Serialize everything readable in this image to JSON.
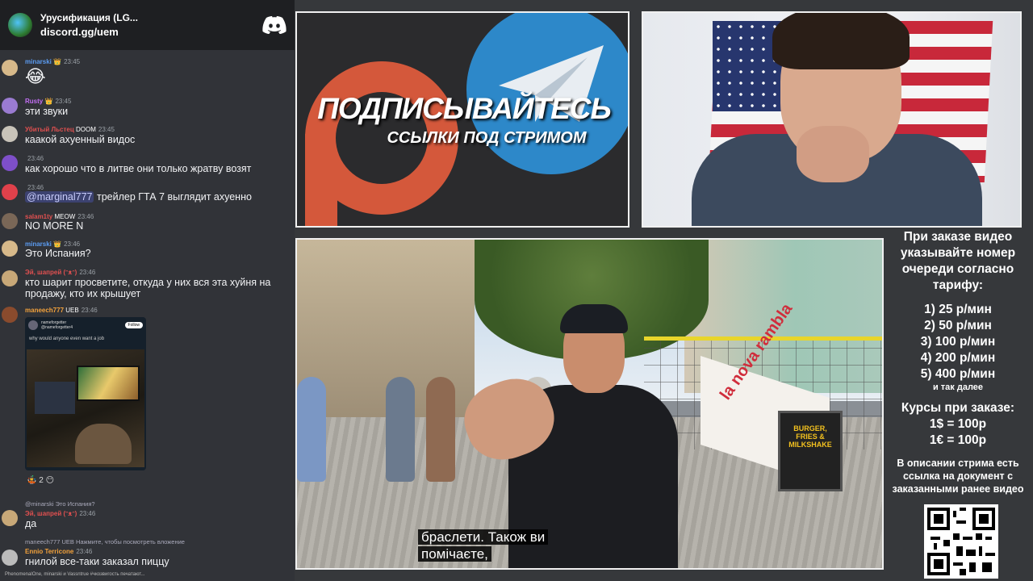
{
  "chat": {
    "server_name": "Урусификация (LG...",
    "server_link": "discord.gg/uem",
    "messages": [
      {
        "name": "minarski",
        "name_color": "#5b9cf2",
        "badges": "👑",
        "time": "23:45",
        "text": "😂",
        "avatar_color": "#d7b98a"
      },
      {
        "name": "Rusty",
        "name_color": "#c36ef5",
        "badges": "👑",
        "time": "23:45",
        "text": "эти звуки",
        "avatar_color": "#9a7bd1"
      },
      {
        "name": "Убитый Льстец",
        "name_color": "#e05050",
        "badges": "DOOM",
        "time": "23:45",
        "text": "каакой ахуенный видос",
        "avatar_color": "#c8c3b9"
      },
      {
        "name": "",
        "name_color": "#888888",
        "badges": "",
        "time": "23:46",
        "text": "как хорошо что в литве они только жратву возят",
        "avatar_color": "#7e4fc9"
      },
      {
        "name": "",
        "name_color": "#888888",
        "badges": "",
        "time": "23:46",
        "mention": "@marginal777",
        "text": "трейлер ГТА 7 выглядит ахуенно",
        "avatar_color": "#e0414b"
      },
      {
        "name": "salam1ty",
        "name_color": "#e05050",
        "badges": "MEOW",
        "time": "23:46",
        "text": "NO MORE N",
        "avatar_color": "#7a6757"
      },
      {
        "name": "minarski",
        "name_color": "#5b9cf2",
        "badges": "👑",
        "time": "23:46",
        "text": "Это Испания?",
        "avatar_color": "#d7b98a"
      },
      {
        "name": "Эй, шапрей (ᵔᴥᵔ)",
        "name_color": "#e05050",
        "badges": "",
        "time": "23:46",
        "text": "кто шарит просветите, откуда у них вся эта хуйня на продажу, кто их крышует",
        "avatar_color": "#c8a878"
      },
      {
        "name": "maneech777",
        "name_color": "#f2a13b",
        "badges": "UEB",
        "time": "23:46",
        "text": "",
        "avatar_color": "#8a4b2d"
      },
      {
        "name": "Эй, шапрей (ᵔᴥᵔ)",
        "name_color": "#e05050",
        "badges": "",
        "time": "23:46",
        "text": "да",
        "avatar_color": "#c8a878",
        "reply": "@minarski  Это Испания?"
      },
      {
        "name": "Ennio Terricone",
        "name_color": "#f2a13b",
        "badges": "",
        "time": "23:46",
        "text": "гнилой все-таки заказал пиццу",
        "avatar_color": "#bbbbbb",
        "reply": "maneech777 UEB  Нажмите, чтобы посмотреть вложение"
      }
    ],
    "embed": {
      "user": "nameforgetter",
      "handle": "@nameforgetter4",
      "follow": "Follow",
      "text": "why would anyone even want a job"
    },
    "reactions": "🤹 2   😶",
    "typing": "PhenomenalOne, minarski и Vassntrue #чкозвигость печатают..."
  },
  "promo": {
    "title": "ПОДПИСЫВАЙТЕСЬ",
    "subtitle": "ССЫЛКИ ПОД СТРИМОМ"
  },
  "video": {
    "banner": "la nova rambla",
    "sign": "BURGER, FRIES & MILKSHAKE",
    "subtitle_line1": "браслети.  Також ви",
    "subtitle_line2": "помічаєте,"
  },
  "info": {
    "heading": [
      "При заказе видео",
      "указывайте номер",
      "очереди согласно",
      "тарифу:"
    ],
    "tariffs": [
      "1) 25 р/мин",
      "2) 50 р/мин",
      "3) 100 р/мин",
      "4) 200 р/мин",
      "5) 400 р/мин"
    ],
    "tariffs_more": "и так далее",
    "courses_title": "Курсы при заказе:",
    "courses": [
      "1$ = 100р",
      "1€ = 100р"
    ],
    "description": "В описании стрима есть ссылка на документ с заказанными ранее видео"
  }
}
